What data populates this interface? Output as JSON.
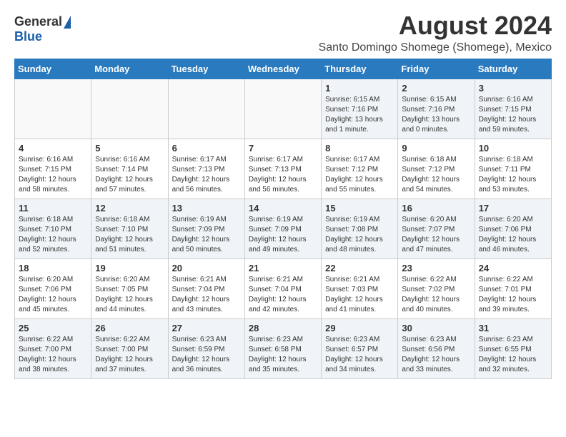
{
  "header": {
    "logo_general": "General",
    "logo_blue": "Blue",
    "month_year": "August 2024",
    "location": "Santo Domingo Shomege (Shomege), Mexico"
  },
  "weekdays": [
    "Sunday",
    "Monday",
    "Tuesday",
    "Wednesday",
    "Thursday",
    "Friday",
    "Saturday"
  ],
  "weeks": [
    [
      {
        "day": "",
        "info": ""
      },
      {
        "day": "",
        "info": ""
      },
      {
        "day": "",
        "info": ""
      },
      {
        "day": "",
        "info": ""
      },
      {
        "day": "1",
        "info": "Sunrise: 6:15 AM\nSunset: 7:16 PM\nDaylight: 13 hours\nand 1 minute."
      },
      {
        "day": "2",
        "info": "Sunrise: 6:15 AM\nSunset: 7:16 PM\nDaylight: 13 hours\nand 0 minutes."
      },
      {
        "day": "3",
        "info": "Sunrise: 6:16 AM\nSunset: 7:15 PM\nDaylight: 12 hours\nand 59 minutes."
      }
    ],
    [
      {
        "day": "4",
        "info": "Sunrise: 6:16 AM\nSunset: 7:15 PM\nDaylight: 12 hours\nand 58 minutes."
      },
      {
        "day": "5",
        "info": "Sunrise: 6:16 AM\nSunset: 7:14 PM\nDaylight: 12 hours\nand 57 minutes."
      },
      {
        "day": "6",
        "info": "Sunrise: 6:17 AM\nSunset: 7:13 PM\nDaylight: 12 hours\nand 56 minutes."
      },
      {
        "day": "7",
        "info": "Sunrise: 6:17 AM\nSunset: 7:13 PM\nDaylight: 12 hours\nand 56 minutes."
      },
      {
        "day": "8",
        "info": "Sunrise: 6:17 AM\nSunset: 7:12 PM\nDaylight: 12 hours\nand 55 minutes."
      },
      {
        "day": "9",
        "info": "Sunrise: 6:18 AM\nSunset: 7:12 PM\nDaylight: 12 hours\nand 54 minutes."
      },
      {
        "day": "10",
        "info": "Sunrise: 6:18 AM\nSunset: 7:11 PM\nDaylight: 12 hours\nand 53 minutes."
      }
    ],
    [
      {
        "day": "11",
        "info": "Sunrise: 6:18 AM\nSunset: 7:10 PM\nDaylight: 12 hours\nand 52 minutes."
      },
      {
        "day": "12",
        "info": "Sunrise: 6:18 AM\nSunset: 7:10 PM\nDaylight: 12 hours\nand 51 minutes."
      },
      {
        "day": "13",
        "info": "Sunrise: 6:19 AM\nSunset: 7:09 PM\nDaylight: 12 hours\nand 50 minutes."
      },
      {
        "day": "14",
        "info": "Sunrise: 6:19 AM\nSunset: 7:09 PM\nDaylight: 12 hours\nand 49 minutes."
      },
      {
        "day": "15",
        "info": "Sunrise: 6:19 AM\nSunset: 7:08 PM\nDaylight: 12 hours\nand 48 minutes."
      },
      {
        "day": "16",
        "info": "Sunrise: 6:20 AM\nSunset: 7:07 PM\nDaylight: 12 hours\nand 47 minutes."
      },
      {
        "day": "17",
        "info": "Sunrise: 6:20 AM\nSunset: 7:06 PM\nDaylight: 12 hours\nand 46 minutes."
      }
    ],
    [
      {
        "day": "18",
        "info": "Sunrise: 6:20 AM\nSunset: 7:06 PM\nDaylight: 12 hours\nand 45 minutes."
      },
      {
        "day": "19",
        "info": "Sunrise: 6:20 AM\nSunset: 7:05 PM\nDaylight: 12 hours\nand 44 minutes."
      },
      {
        "day": "20",
        "info": "Sunrise: 6:21 AM\nSunset: 7:04 PM\nDaylight: 12 hours\nand 43 minutes."
      },
      {
        "day": "21",
        "info": "Sunrise: 6:21 AM\nSunset: 7:04 PM\nDaylight: 12 hours\nand 42 minutes."
      },
      {
        "day": "22",
        "info": "Sunrise: 6:21 AM\nSunset: 7:03 PM\nDaylight: 12 hours\nand 41 minutes."
      },
      {
        "day": "23",
        "info": "Sunrise: 6:22 AM\nSunset: 7:02 PM\nDaylight: 12 hours\nand 40 minutes."
      },
      {
        "day": "24",
        "info": "Sunrise: 6:22 AM\nSunset: 7:01 PM\nDaylight: 12 hours\nand 39 minutes."
      }
    ],
    [
      {
        "day": "25",
        "info": "Sunrise: 6:22 AM\nSunset: 7:00 PM\nDaylight: 12 hours\nand 38 minutes."
      },
      {
        "day": "26",
        "info": "Sunrise: 6:22 AM\nSunset: 7:00 PM\nDaylight: 12 hours\nand 37 minutes."
      },
      {
        "day": "27",
        "info": "Sunrise: 6:23 AM\nSunset: 6:59 PM\nDaylight: 12 hours\nand 36 minutes."
      },
      {
        "day": "28",
        "info": "Sunrise: 6:23 AM\nSunset: 6:58 PM\nDaylight: 12 hours\nand 35 minutes."
      },
      {
        "day": "29",
        "info": "Sunrise: 6:23 AM\nSunset: 6:57 PM\nDaylight: 12 hours\nand 34 minutes."
      },
      {
        "day": "30",
        "info": "Sunrise: 6:23 AM\nSunset: 6:56 PM\nDaylight: 12 hours\nand 33 minutes."
      },
      {
        "day": "31",
        "info": "Sunrise: 6:23 AM\nSunset: 6:55 PM\nDaylight: 12 hours\nand 32 minutes."
      }
    ]
  ]
}
